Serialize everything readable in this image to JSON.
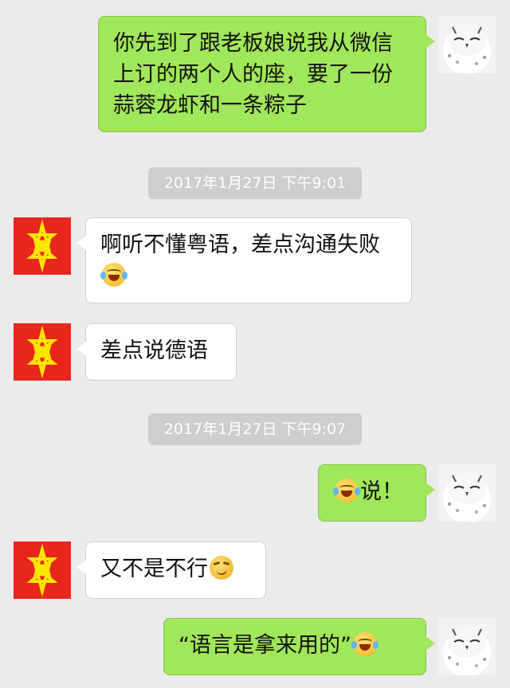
{
  "messages": [
    {
      "text": "你先到了跟老板娘说我从微信上订的两个人的座，要了一份蒜蓉龙虾和一条粽子"
    },
    {
      "timestamp": "2017年1月27日 下午9:01"
    },
    {
      "text": "啊听不懂粤语，差点沟通失败"
    },
    {
      "text": "差点说德语"
    },
    {
      "timestamp": "2017年1月27日 下午9:07"
    },
    {
      "text": "说！"
    },
    {
      "text": "又不是不行"
    },
    {
      "text": "“语言是拿来用的”"
    }
  ],
  "icons": {
    "laugh_cry": "face-with-tears-of-joy-icon",
    "smirk": "smirking-face-icon"
  },
  "colors": {
    "background": "#ebebeb",
    "my_bubble": "#a0e75a",
    "their_bubble": "#ffffff",
    "timestamp_bg": "#cecece",
    "star_avatar_bg": "#e8261c",
    "star_avatar_fg": "#ffe600"
  }
}
